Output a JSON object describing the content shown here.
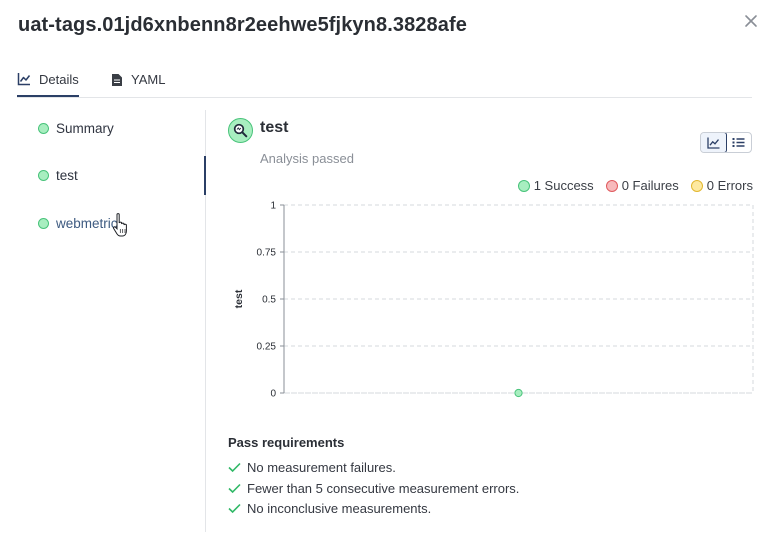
{
  "header": {
    "title": "uat-tags.01jd6xnbenn8r2eehwe5fjkyn8.3828afe"
  },
  "tabs": [
    {
      "label": "Details",
      "icon": "line-chart-icon",
      "active": true
    },
    {
      "label": "YAML",
      "icon": "file-icon",
      "active": false
    }
  ],
  "sidebar": {
    "items": [
      {
        "label": "Summary",
        "status": "success"
      },
      {
        "label": "test",
        "status": "success",
        "active": true
      },
      {
        "label": "webmetric",
        "status": "success"
      }
    ]
  },
  "analysis": {
    "name": "test",
    "status_text": "Analysis passed",
    "icon": "magnify-analysis-icon"
  },
  "legend": {
    "success_label": "1 Success",
    "failures_label": "0 Failures",
    "errors_label": "0 Errors"
  },
  "colors": {
    "success_fill": "#a8eec0",
    "success_stroke": "#48c37a",
    "failure_fill": "#f7b9bb",
    "failure_stroke": "#e05a5e",
    "error_fill": "#fde9a0",
    "error_stroke": "#e2b730",
    "accent": "#2b3f66"
  },
  "chart_data": {
    "type": "scatter",
    "ylabel": "test",
    "xlabel": "",
    "ylim": [
      0,
      1
    ],
    "y_ticks": [
      "0",
      "0.25",
      "0.5",
      "0.75",
      "1"
    ],
    "grid": true,
    "points": [
      {
        "x": 0.5,
        "y": 0,
        "status": "success"
      }
    ]
  },
  "requirements": {
    "title": "Pass requirements",
    "items": [
      "No measurement failures.",
      "Fewer than 5 consecutive measurement errors.",
      "No inconclusive measurements."
    ]
  }
}
